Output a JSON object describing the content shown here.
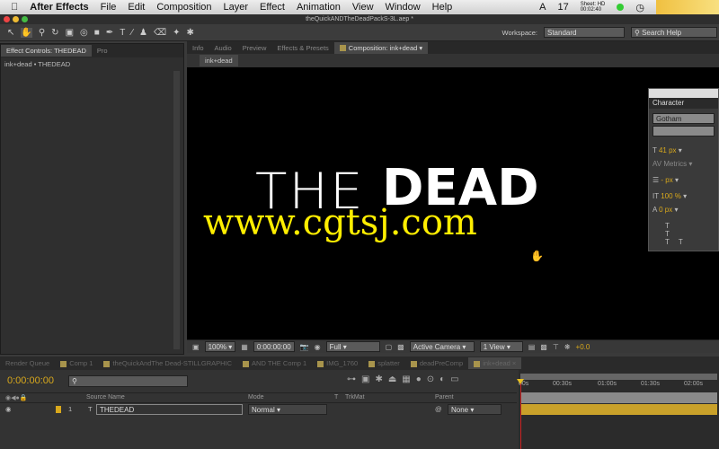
{
  "menubar": {
    "apple": "",
    "items": [
      "After Effects",
      "File",
      "Edit",
      "Composition",
      "Layer",
      "Effect",
      "Animation",
      "View",
      "Window",
      "Help"
    ],
    "status": {
      "clock_num": "17",
      "meter_label": "Sheet: HD",
      "meter_time": "00:02:40"
    }
  },
  "window": {
    "title": "theQuickANDTheDeadPackS-3L.aep *"
  },
  "toolbar": {
    "workspace_label": "Workspace:",
    "workspace_value": "Standard",
    "search_placeholder": "Search Help"
  },
  "left_panel": {
    "tab": "Effect Controls: THEDEAD",
    "tab2": "Pro",
    "breadcrumb": "ink+dead • THEDEAD"
  },
  "viewer_tabs": [
    "Info",
    "Audio",
    "Preview",
    "Effects & Presets"
  ],
  "comp_tab": "Composition: ink+dead",
  "comp_subtab": "ink+dead",
  "canvas": {
    "word1": "THE",
    "word2": "DEAD",
    "watermark": "www.cgtsj.com"
  },
  "viewer_bar": {
    "zoom": "100%",
    "timecode": "0:00:00:00",
    "resolution": "Full",
    "camera": "Active Camera",
    "views": "1 View",
    "exposure": "+0.0"
  },
  "character": {
    "title": "Character",
    "font": "Gotham",
    "size": "41 px",
    "kerning": "Metrics",
    "leading": "- px",
    "vscale": "100 %",
    "baseline": "0 px"
  },
  "timeline_tabs": [
    "Render Queue",
    "Comp 1",
    "theQuickAndThe Dead-STILLGRAPHIC",
    "AND THE Comp 1",
    "IMG_1760",
    "splatter",
    "deadPreComp",
    "ink+dead"
  ],
  "timeline": {
    "timecode": "0:00:00:00",
    "columns": {
      "source": "Source Name",
      "mode": "Mode",
      "t": "T",
      "trkmat": "TrkMat",
      "parent": "Parent"
    },
    "ruler": [
      "00s",
      "00:30s",
      "01:00s",
      "01:30s",
      "02:00s"
    ],
    "layers": [
      {
        "num": "1",
        "name": "THEDEAD",
        "mode": "Normal",
        "parent": "None"
      }
    ]
  },
  "colors": {
    "accent": "#d8a81c",
    "watermark": "#ffee00"
  }
}
